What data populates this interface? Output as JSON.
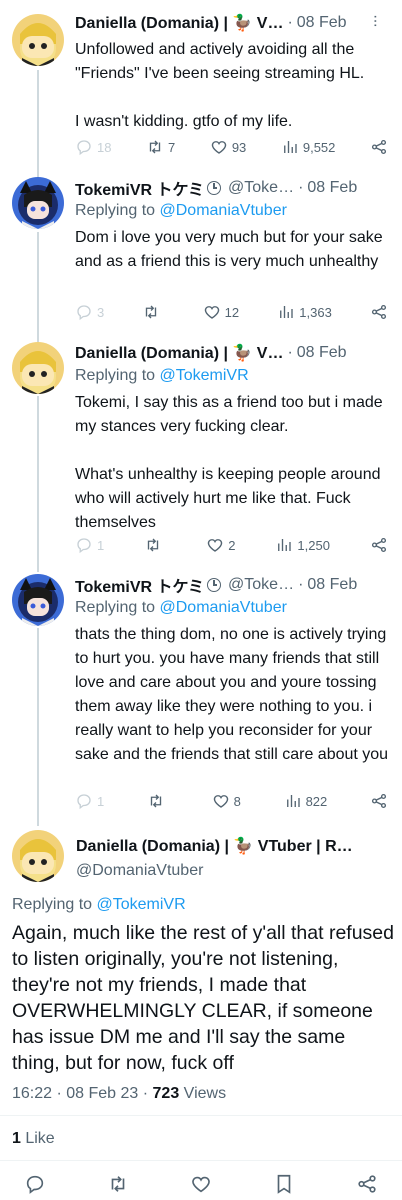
{
  "tweets": [
    {
      "name": "Daniella (Domania) | 🦆 V…",
      "handle": "",
      "date": "08 Feb",
      "reply_prefix": "",
      "reply_mention": "",
      "text": "Unfollowed and actively avoiding all the \"Friends\" I've been seeing streaming HL.\n\nI wasn't kidding. gtfo of my life.",
      "replies": "18",
      "retweets": "7",
      "likes": "93",
      "views": "9,552"
    },
    {
      "name": "TokemiVR トケミ",
      "handle": "@Toke…",
      "date": "08 Feb",
      "reply_prefix": "Replying to",
      "reply_mention": "@DomaniaVtuber",
      "text": "Dom i love you very much but for your sake and as a friend this is very much unhealthy",
      "replies": "3",
      "retweets": "",
      "likes": "12",
      "views": "1,363"
    },
    {
      "name": "Daniella (Domania) | 🦆 V…",
      "handle": "",
      "date": "08 Feb",
      "reply_prefix": "Replying to",
      "reply_mention": "@TokemiVR",
      "text": "Tokemi, I say this as a friend too but i made my stances very fucking clear.\n\nWhat's unhealthy is keeping people around who will actively hurt me like that. Fuck themselves",
      "replies": "1",
      "retweets": "",
      "likes": "2",
      "views": "1,250"
    },
    {
      "name": "TokemiVR トケミ",
      "handle": "@Toke…",
      "date": "08 Feb",
      "reply_prefix": "Replying to",
      "reply_mention": "@DomaniaVtuber",
      "text": "thats the thing dom, no one is actively trying to hurt you. you have many friends that still love and care about you and youre tossing them away like they were nothing to you. i really want to help you reconsider for your sake and the friends that still care about you",
      "replies": "1",
      "retweets": "",
      "likes": "8",
      "views": "822"
    }
  ],
  "main": {
    "name": "Daniella (Domania) | 🦆 VTuber | R…",
    "handle": "@DomaniaVtuber",
    "reply_prefix": "Replying to",
    "reply_mention": "@TokemiVR",
    "text": "Again, much like the rest of y'all that refused to listen originally, you're not listening, they're not my friends, I made that OVERWHELMINGLY CLEAR, if someone has issue DM me and I'll say the same thing, but for now, fuck off",
    "time": "16:22 · 08 Feb 23 · ",
    "views_count": "723",
    "views_label": " Views",
    "likes_count": "1",
    "likes_label": " Like"
  },
  "icons": {
    "reply": "reply-icon",
    "retweet": "retweet-icon",
    "like": "heart-icon",
    "views": "views-icon",
    "share": "share-icon",
    "bookmark": "bookmark-icon",
    "more": "more-icon"
  },
  "colors": {
    "accent": "#1d9bf0",
    "secondary_text": "#536471",
    "primary_text": "#0f1419",
    "thread_line": "#cfd9de"
  }
}
